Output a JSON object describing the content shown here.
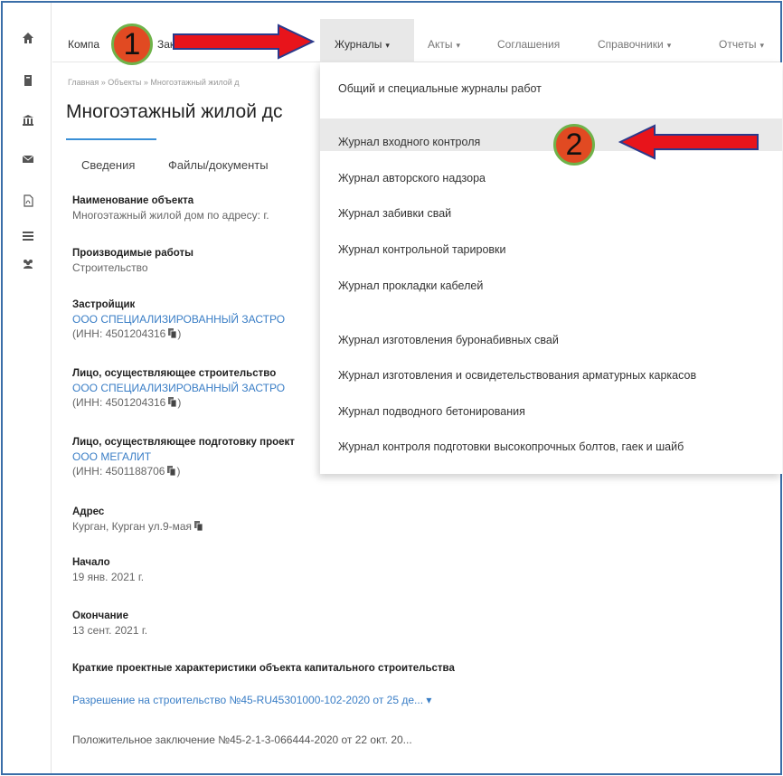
{
  "topnav": {
    "company": "Компа",
    "company_tail": "Зак",
    "journals": "Журналы",
    "acts": "Акты",
    "agreements": "Соглашения",
    "directories": "Справочники",
    "reports": "Отчеты"
  },
  "breadcrumb": "Главная » Объекты » Многоэтажный жилой д",
  "page_title": "Многоэтажный жилой дс",
  "tabs": [
    "Сведения",
    "Файлы/документы"
  ],
  "fields": [
    {
      "label": "Наименование объекта",
      "value": "Многоэтажный жилой дом по адресу: г."
    },
    {
      "label": "Производимые работы",
      "value": "Строительство"
    },
    {
      "label": "Застройщик",
      "link": "ООО СПЕЦИАЛИЗИРОВАННЫЙ ЗАСТРО",
      "value": "(ИНН: 4501204316"
    },
    {
      "label": "Лицо, осуществляющее строительство",
      "link": "ООО СПЕЦИАЛИЗИРОВАННЫЙ ЗАСТРО",
      "value": "(ИНН: 4501204316"
    },
    {
      "label": "Лицо, осуществляющее подготовку проект",
      "link": "ООО МЕГАЛИТ",
      "value": "(ИНН: 4501188706"
    },
    {
      "label": "Адрес",
      "value": "Курган, Курган ул.9-мая"
    },
    {
      "label": "Начало",
      "value": "19 янв. 2021 г."
    },
    {
      "label": "Окончание",
      "value": "13 сент. 2021 г."
    }
  ],
  "copy_suffix": ")",
  "short_title": "Краткие проектные характеристики объекта капитального строительства",
  "permit_link": "Разрешение на строительство №45-RU45301000-102-2020 от 25 де... ▾",
  "conclusion": "Положительное заключение №45-2-1-3-066444-2020 от 22 окт. 20...",
  "dropdown": [
    "Общий и специальные журналы работ",
    "Журнал входного контроля",
    "Журнал авторского надзора",
    "Журнал забивки свай",
    "Журнал контрольной тарировки",
    "Журнал прокладки кабелей",
    "Журнал изготовления буронабивных свай",
    "Журнал изготовления и освидетельствования арматурных каркасов",
    "Журнал подводного бетонирования",
    "Журнал контроля подготовки высокопрочных болтов, гаек и шайб"
  ],
  "annotations": {
    "step1": "1",
    "step2": "2"
  },
  "colors": {
    "accent": "#3a7ec6",
    "badge": "#e14a22",
    "arrow": "#e8141b",
    "arrow_outline": "#2b3a8c"
  },
  "icons": [
    "home-icon",
    "book-icon",
    "bank-icon",
    "mail-icon",
    "pdf-icon",
    "list-icon",
    "users-icon"
  ]
}
